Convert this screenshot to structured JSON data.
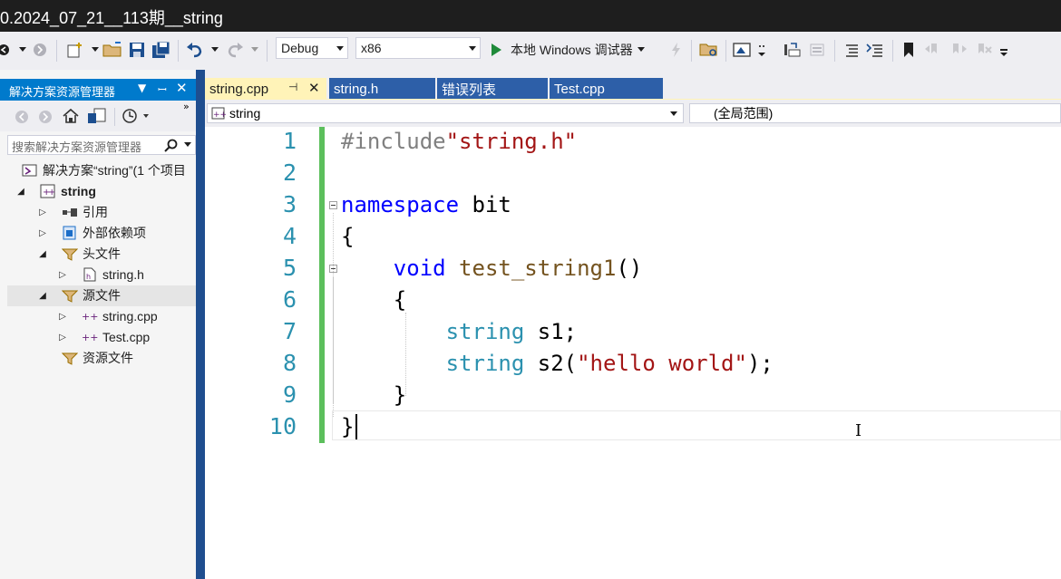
{
  "window": {
    "title": "0.2024_07_21__113期__string"
  },
  "toolbar": {
    "config": "Debug",
    "platform": "x86",
    "run_label": "本地 Windows 调试器"
  },
  "solution_explorer": {
    "title": "解决方案资源管理器",
    "search_placeholder": "搜索解决方案资源管理器",
    "solution_label": "解决方案“string”(1 个项目",
    "project": "string",
    "nodes": [
      "引用",
      "外部依赖项",
      "头文件",
      "string.h",
      "源文件",
      "string.cpp",
      "Test.cpp",
      "资源文件"
    ]
  },
  "tabs": [
    {
      "label": "string.cpp",
      "active": true
    },
    {
      "label": "string.h",
      "active": false
    },
    {
      "label": "错误列表",
      "active": false
    },
    {
      "label": "Test.cpp",
      "active": false
    }
  ],
  "nav": {
    "scope": "string",
    "member": "(全局范围)"
  },
  "editor": {
    "line_numbers": [
      "1",
      "2",
      "3",
      "4",
      "5",
      "6",
      "7",
      "8",
      "9",
      "10"
    ],
    "lines": [
      {
        "parts": [
          {
            "t": "#include",
            "c": "pp"
          },
          {
            "t": "\"string.h\"",
            "c": "st"
          }
        ]
      },
      {
        "parts": []
      },
      {
        "parts": [
          {
            "t": "namespace",
            "c": "kw"
          },
          {
            "t": " bit",
            "c": ""
          }
        ]
      },
      {
        "parts": [
          {
            "t": "{",
            "c": ""
          }
        ]
      },
      {
        "parts": [
          {
            "t": "    ",
            "c": ""
          },
          {
            "t": "void",
            "c": "kw"
          },
          {
            "t": " ",
            "c": ""
          },
          {
            "t": "test_string1",
            "c": "fn"
          },
          {
            "t": "()",
            "c": ""
          }
        ]
      },
      {
        "parts": [
          {
            "t": "    {",
            "c": ""
          }
        ]
      },
      {
        "parts": [
          {
            "t": "        ",
            "c": ""
          },
          {
            "t": "string",
            "c": "ty"
          },
          {
            "t": " s1;",
            "c": ""
          }
        ]
      },
      {
        "parts": [
          {
            "t": "        ",
            "c": ""
          },
          {
            "t": "string",
            "c": "ty"
          },
          {
            "t": " s2(",
            "c": ""
          },
          {
            "t": "\"hello world\"",
            "c": "st"
          },
          {
            "t": ");",
            "c": ""
          }
        ]
      },
      {
        "parts": [
          {
            "t": "    }",
            "c": ""
          }
        ]
      },
      {
        "parts": [
          {
            "t": "}",
            "c": ""
          }
        ]
      }
    ]
  }
}
